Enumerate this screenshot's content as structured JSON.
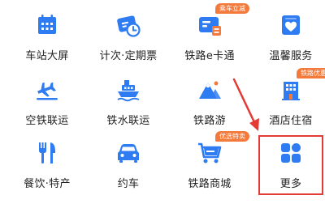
{
  "colors": {
    "icon_blue": "#2f7bf2",
    "badge_orange": "#f47a3c",
    "annotation_red": "#e53935"
  },
  "services": [
    {
      "label": "车站大屏",
      "icon": "station-screen-icon"
    },
    {
      "label": "计次·定期票",
      "icon": "ticket-clock-icon"
    },
    {
      "label": "铁路e卡通",
      "icon": "railway-card-icon",
      "badge": "乘车立减"
    },
    {
      "label": "温馨服务",
      "icon": "heart-service-icon"
    },
    {
      "label": "空铁联运",
      "icon": "plane-train-icon"
    },
    {
      "label": "铁水联运",
      "icon": "ship-icon"
    },
    {
      "label": "铁路游",
      "icon": "mountain-travel-icon"
    },
    {
      "label": "酒店住宿",
      "icon": "hotel-icon",
      "badge": "铁路优惠"
    },
    {
      "label": "餐饮·特产",
      "icon": "dining-icon"
    },
    {
      "label": "约车",
      "icon": "car-icon"
    },
    {
      "label": "铁路商城",
      "icon": "shopping-cart-icon",
      "badge": "优选特卖"
    },
    {
      "label": "更多",
      "icon": "more-grid-icon"
    }
  ]
}
